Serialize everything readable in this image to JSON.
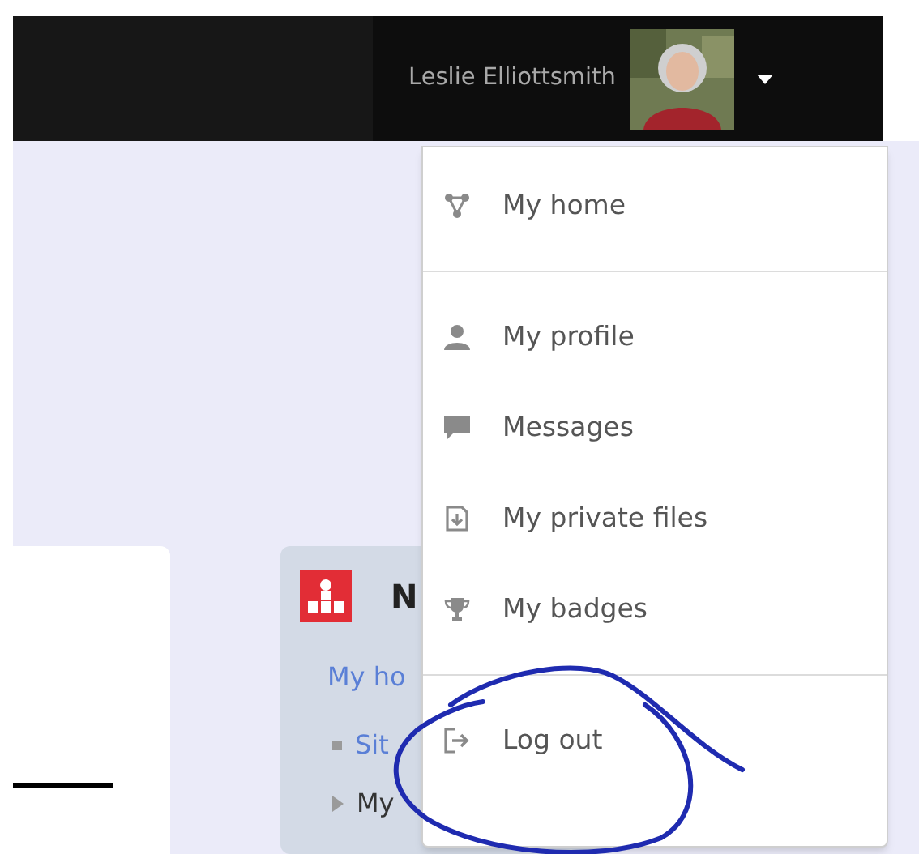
{
  "navbar": {
    "user_name": "Leslie Elliottsmith"
  },
  "user_menu": {
    "items": [
      {
        "kind": "link",
        "label": "My home"
      },
      {
        "kind": "divider"
      },
      {
        "kind": "link",
        "label": "My profile"
      },
      {
        "kind": "link",
        "label": "Messages"
      },
      {
        "kind": "link",
        "label": "My private files"
      },
      {
        "kind": "link",
        "label": "My badges"
      },
      {
        "kind": "divider"
      },
      {
        "kind": "link",
        "label": "Log out"
      }
    ]
  },
  "navigation_block": {
    "title": "N",
    "link": "My ho",
    "items": [
      {
        "kind": "bullet",
        "label": "Sit"
      },
      {
        "kind": "branch",
        "label": "My"
      }
    ]
  }
}
